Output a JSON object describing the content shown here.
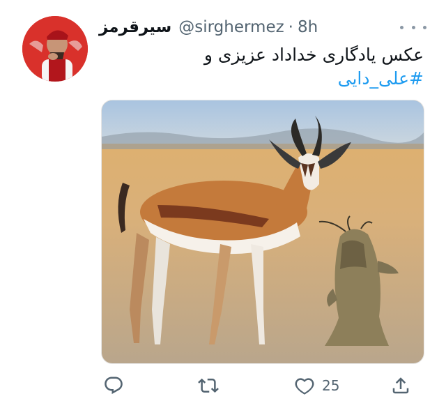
{
  "tweet": {
    "display_name": "سیرقرمز",
    "handle": "@sirghermez",
    "separator": "·",
    "time": "8h",
    "text_line1": "عکس یادگاری خداداد عزیزی و",
    "hashtag": "#علی_دایی",
    "like_count": "25"
  },
  "icons": {
    "more": "more-horizontal-icon",
    "reply": "reply-icon",
    "retweet": "retweet-icon",
    "like": "heart-icon",
    "share": "share-icon"
  },
  "colors": {
    "link": "#1d9bf0",
    "secondary_text": "#536471",
    "avatar_bg": "#d9312b"
  }
}
